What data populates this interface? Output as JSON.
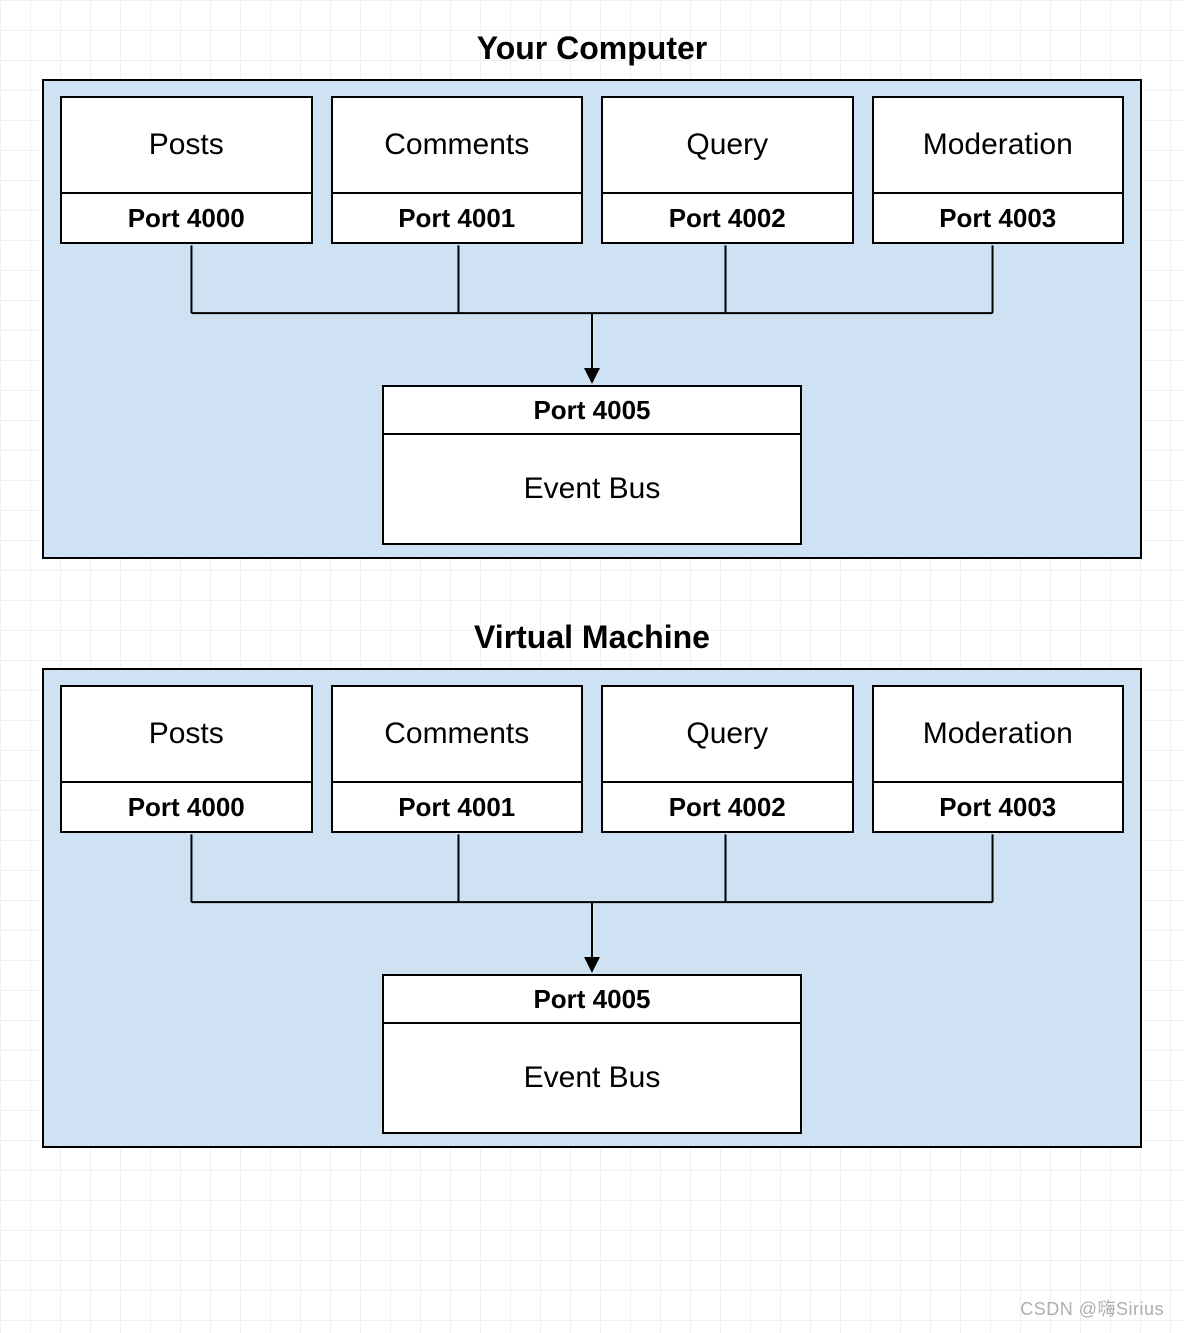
{
  "sections": [
    {
      "title": "Your Computer",
      "services": [
        {
          "name": "Posts",
          "port": "Port 4000"
        },
        {
          "name": "Comments",
          "port": "Port 4001"
        },
        {
          "name": "Query",
          "port": "Port 4002"
        },
        {
          "name": "Moderation",
          "port": "Port 4003"
        }
      ],
      "bus": {
        "port": "Port 4005",
        "name": "Event Bus"
      }
    },
    {
      "title": "Virtual Machine",
      "services": [
        {
          "name": "Posts",
          "port": "Port 4000"
        },
        {
          "name": "Comments",
          "port": "Port 4001"
        },
        {
          "name": "Query",
          "port": "Port 4002"
        },
        {
          "name": "Moderation",
          "port": "Port 4003"
        }
      ],
      "bus": {
        "port": "Port 4005",
        "name": "Event Bus"
      }
    }
  ],
  "watermark": "CSDN @嗨Sirius"
}
